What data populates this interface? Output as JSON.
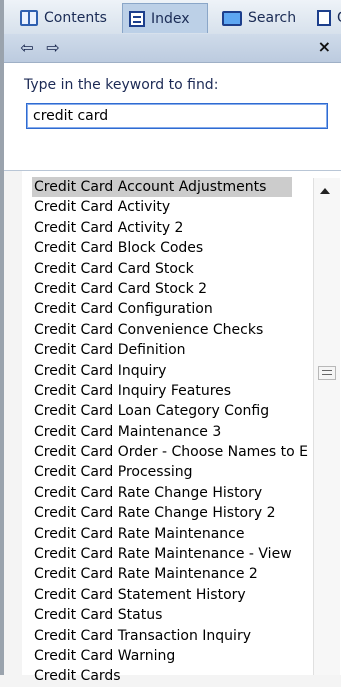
{
  "tabs": [
    {
      "label": "Contents",
      "icon": "book-icon"
    },
    {
      "label": "Index",
      "icon": "index-icon",
      "active": true
    },
    {
      "label": "Search",
      "icon": "search-icon"
    },
    {
      "label": "G",
      "icon": "glossary-icon"
    }
  ],
  "nav": {
    "back": "⇦",
    "forward": "⇨",
    "close": "×"
  },
  "search": {
    "prompt": "Type in the keyword to find:",
    "value": "credit card"
  },
  "list": {
    "items": [
      "Credit Card Account Adjustments",
      "Credit Card Activity",
      "Credit Card Activity 2",
      "Credit Card Block Codes",
      "Credit Card Card Stock",
      "Credit Card Card Stock 2",
      "Credit Card Configuration",
      "Credit Card Convenience Checks",
      "Credit Card Definition",
      "Credit Card Inquiry",
      "Credit Card Inquiry Features",
      "Credit Card Loan Category Config",
      "Credit Card Maintenance 3",
      "Credit Card Order - Choose Names to E",
      "Credit Card Processing",
      "Credit Card Rate Change History",
      "Credit Card Rate Change History 2",
      "Credit Card Rate Maintenance",
      "Credit Card Rate Maintenance - View",
      "Credit Card Rate Maintenance 2",
      "Credit Card Statement History",
      "Credit Card Status",
      "Credit Card Transaction Inquiry",
      "Credit Card Warning",
      "Credit Cards"
    ],
    "selected_index": 0
  },
  "colors": {
    "selected": "#cccccc",
    "tab_text": "#1a2b55"
  }
}
